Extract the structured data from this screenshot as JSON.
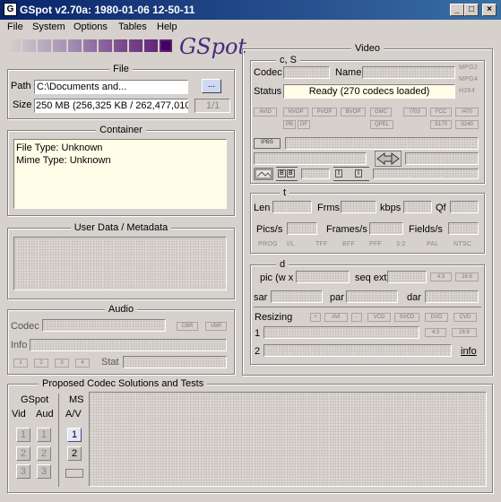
{
  "window": {
    "title": "GSpot v2.70a: 1980-01-06 12-50-11",
    "min": "_",
    "max": "□",
    "close": "×"
  },
  "menu": [
    "File",
    "System",
    "Options",
    "Tables",
    "Help"
  ],
  "logo": "GSpot",
  "file": {
    "legend": "File",
    "path_label": "Path",
    "path_value": "C:\\Documents and...",
    "browse_label": "...",
    "size_label": "Size",
    "size_value": "250 MB (256,325 KB / 262,477,010",
    "page_counter": "1/1"
  },
  "container": {
    "legend": "Container",
    "file_type": "File Type: Unknown",
    "mime_type": "Mime Type: Unknown"
  },
  "userdata": {
    "legend": "User Data / Metadata"
  },
  "audio": {
    "legend": "Audio",
    "codec_label": "Codec",
    "cbr": "CBR",
    "vbr": "VBR",
    "info_label": "Info",
    "stat_label": "Stat",
    "buttons": [
      "1",
      "2",
      "3",
      "4"
    ]
  },
  "video": {
    "legend": "Video",
    "cs_legend": "c, S",
    "codec_label": "Codec",
    "name_label": "Name",
    "status_label": "Status",
    "status_value": "Ready (270 codecs loaded)",
    "mpg2": "MPG2",
    "mpg4": "MPG4",
    "h264": "H264",
    "flags_row1": [
      "AVID",
      "NVOP",
      "PVOP",
      "BVOP",
      "GMC",
      "I703",
      "FCC",
      "I470"
    ],
    "flags_row2": [
      "PB",
      "DF",
      "QPEL",
      "S170",
      "S240"
    ],
    "ipbs": "IPBS",
    "t_legend": "t",
    "len_label": "Len",
    "frms_label": "Frms",
    "kbps_label": "kbps",
    "qf_label": "Qf",
    "pics_label": "Pics/s",
    "frames_label": "Frames/s",
    "fields_label": "Fields/s",
    "prog_flags": [
      "PROG",
      "I/L",
      "TFF",
      "BFF",
      "PFF",
      "3:2",
      "PAL",
      "NTSC"
    ],
    "d_legend": "d",
    "pic_label": "pic (w x",
    "seqext_label": "seq ext",
    "r43": "4:3",
    "r169": "16:9",
    "sar_label": "sar",
    "par_label": "par",
    "dar_label": "dar",
    "resizing_label": "Resizing",
    "resize_btns": [
      "+",
      "AVI",
      "-",
      "VCD",
      "SVCD",
      "DVD",
      "CVD"
    ],
    "line1": "1",
    "line2": "2",
    "r43b": "4:3",
    "r169b": "16:9",
    "info_link": "info"
  },
  "proposed": {
    "legend": "Proposed Codec Solutions and Tests",
    "gspot": "GSpot",
    "vid": "Vid",
    "aud": "Aud",
    "ms": "MS",
    "av": "A/V",
    "nums": [
      "1",
      "2",
      "3"
    ]
  }
}
